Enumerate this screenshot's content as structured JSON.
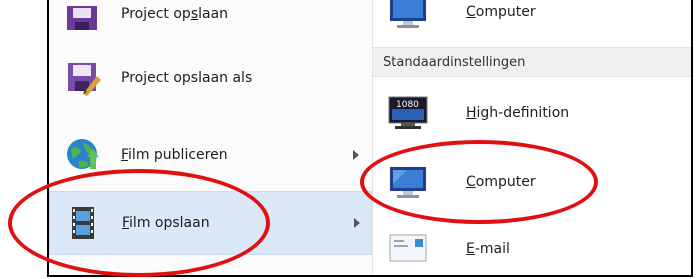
{
  "left_menu": {
    "items": [
      {
        "pre": "Project op",
        "ul": "s",
        "post": "laan"
      },
      {
        "pre": "Pro",
        "ul": "j",
        "post": "ect opslaan als"
      },
      {
        "pre": "",
        "ul": "F",
        "post": "ilm publiceren"
      },
      {
        "pre": "",
        "ul": "F",
        "post": "ilm opslaan"
      }
    ]
  },
  "right_menu": {
    "top_item": {
      "pre": "",
      "ul": "C",
      "post": "omputer"
    },
    "section_header": "Standaardinstellingen",
    "items": [
      {
        "pre": "",
        "ul": "H",
        "post": "igh-definition",
        "badge": "1080"
      },
      {
        "pre": "",
        "ul": "C",
        "post": "omputer"
      },
      {
        "pre": "",
        "ul": "E",
        "post": "-mail"
      }
    ]
  },
  "colors": {
    "highlight": "#dbe8f7",
    "annotation": "#e11010"
  },
  "icons": [
    "save-project-icon",
    "save-project-as-icon",
    "globe-publish-icon",
    "film-save-icon",
    "monitor-icon",
    "hd-monitor-icon",
    "email-icon"
  ]
}
